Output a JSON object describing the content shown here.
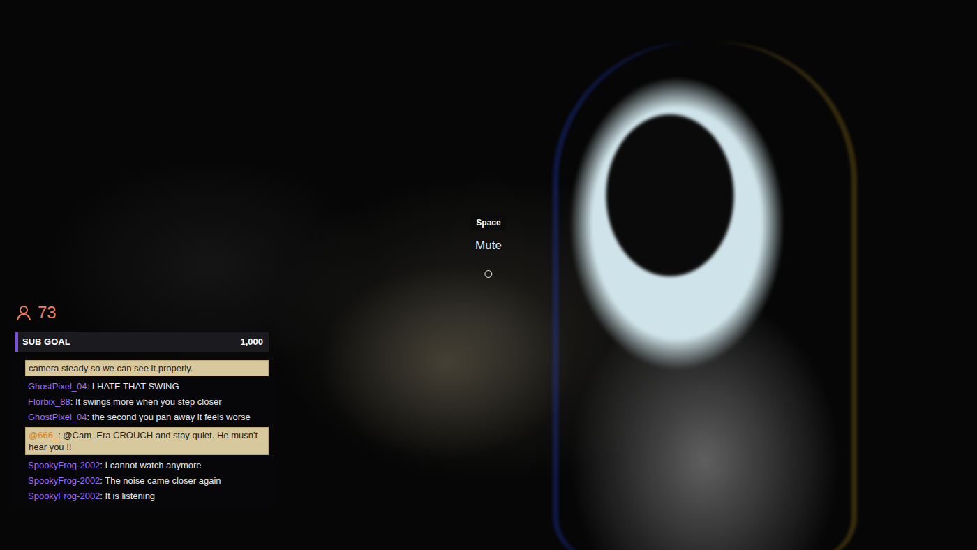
{
  "hud": {
    "viewer_count": "73",
    "sub_goal": {
      "label": "SUB GOAL",
      "value": "1,000",
      "level": 0.01
    }
  },
  "prompt": {
    "key": "Space",
    "action": "Mute"
  },
  "chat": [
    {
      "kind": "highlight",
      "text": "camera steady so we can see it properly."
    },
    {
      "kind": "normal",
      "user": "GhostPixel_04",
      "color": "#9d6cff",
      "text": ": I HATE THAT SWING"
    },
    {
      "kind": "normal",
      "user": "Florbix_88",
      "color": "#9d6cff",
      "text": ": It swings more when you step closer"
    },
    {
      "kind": "normal",
      "user": "GhostPixel_04",
      "color": "#9d6cff",
      "text": ": the second you pan away it feels worse"
    },
    {
      "kind": "highlight",
      "user": "@666_",
      "color": "#e0821c",
      "text": ": @Cam_Era CROUCH and stay quiet. He musn't hear you !!"
    },
    {
      "kind": "normal",
      "user": "SpookyFrog-2002",
      "color": "#9d6cff",
      "text": ": I cannot watch anymore"
    },
    {
      "kind": "normal",
      "user": "SpookyFrog-2002",
      "color": "#9d6cff",
      "text": ": The noise came closer again"
    },
    {
      "kind": "normal",
      "user": "SpookyFrog-2002",
      "color": "#9d6cff",
      "text": ": It is listening"
    }
  ]
}
